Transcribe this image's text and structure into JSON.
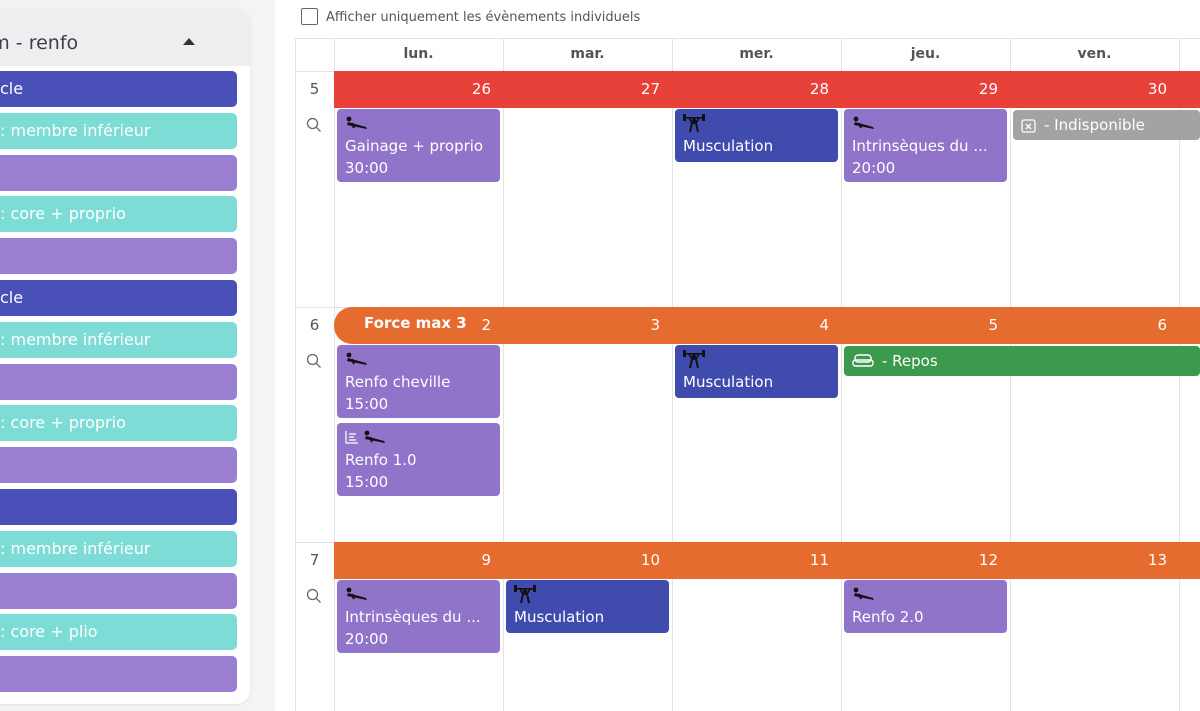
{
  "sidebar": {
    "plan_title": "xm - renfo",
    "items": [
      {
        "label": "cle",
        "color": "#4950b8"
      },
      {
        "label": ": membre inférieur",
        "color": "#7ddcd5"
      },
      {
        "label": "",
        "color": "#9b7fd3"
      },
      {
        "label": ": core + proprio",
        "color": "#7ddcd5"
      },
      {
        "label": "",
        "color": "#9b7fd3"
      },
      {
        "label": "cle",
        "color": "#4950b8"
      },
      {
        "label": ": membre inférieur",
        "color": "#7ddcd5"
      },
      {
        "label": "",
        "color": "#9b7fd3"
      },
      {
        "label": ": core + proprio",
        "color": "#7ddcd5"
      },
      {
        "label": "",
        "color": "#9b7fd3"
      },
      {
        "label": "",
        "color": "#4950b8"
      },
      {
        "label": ": membre inférieur",
        "color": "#7ddcd5"
      },
      {
        "label": "",
        "color": "#9b7fd3"
      },
      {
        "label": ": core + plio",
        "color": "#7ddcd5"
      },
      {
        "label": "",
        "color": "#9b7fd3"
      }
    ]
  },
  "filter": {
    "label": "Afficher uniquement les évènements individuels"
  },
  "days": [
    "lun.",
    "mar.",
    "mer.",
    "jeu.",
    "ven."
  ],
  "weeks": [
    {
      "num": "5",
      "band_color": "red",
      "band_title": "",
      "dates": [
        "26",
        "27",
        "28",
        "29",
        "30"
      ],
      "events": [
        {
          "col": 0,
          "row": 0,
          "color": "purple",
          "icons": [
            "plank-icon"
          ],
          "title": "Gainage + proprio",
          "duration": "30:00"
        },
        {
          "col": 2,
          "row": 0,
          "color": "blue",
          "icons": [
            "weightlifter-icon"
          ],
          "title": "Musculation",
          "duration": ""
        },
        {
          "col": 3,
          "row": 0,
          "color": "purple",
          "icons": [
            "plank-icon"
          ],
          "title": "Intrinsèques du ...",
          "duration": "20:00"
        },
        {
          "col": 4,
          "row": 0,
          "color": "gray",
          "kind": "inline",
          "icons": [
            "calendar-x-icon"
          ],
          "title": "- Indisponible",
          "span": 2
        }
      ]
    },
    {
      "num": "6",
      "band_color": "orange",
      "band_title": "Force max 3",
      "dates": [
        "2",
        "3",
        "4",
        "5",
        "6"
      ],
      "events": [
        {
          "col": 0,
          "row": 0,
          "color": "purple",
          "icons": [
            "plank-icon"
          ],
          "title": "Renfo cheville",
          "duration": "15:00"
        },
        {
          "col": 0,
          "row": 1,
          "color": "purple",
          "icons": [
            "list-icon",
            "plank-icon"
          ],
          "title": "Renfo 1.0",
          "duration": "15:00"
        },
        {
          "col": 2,
          "row": 0,
          "color": "blue",
          "icons": [
            "weightlifter-icon"
          ],
          "title": "Musculation",
          "duration": ""
        },
        {
          "col": 3,
          "row": 0,
          "color": "green",
          "kind": "inline",
          "icons": [
            "sofa-icon"
          ],
          "title": "- Repos",
          "span": 3
        }
      ]
    },
    {
      "num": "7",
      "band_color": "orange",
      "band_title": "",
      "dates": [
        "9",
        "10",
        "11",
        "12",
        "13"
      ],
      "events": [
        {
          "col": 0,
          "row": 0,
          "color": "purple",
          "icons": [
            "plank-icon"
          ],
          "title": "Intrinsèques du ...",
          "duration": "20:00"
        },
        {
          "col": 1,
          "row": 0,
          "color": "blue",
          "icons": [
            "weightlifter-icon"
          ],
          "title": "Musculation",
          "duration": ""
        },
        {
          "col": 3,
          "row": 0,
          "color": "purple",
          "icons": [
            "plank-icon"
          ],
          "title": "Renfo 2.0",
          "duration": ""
        }
      ]
    }
  ]
}
